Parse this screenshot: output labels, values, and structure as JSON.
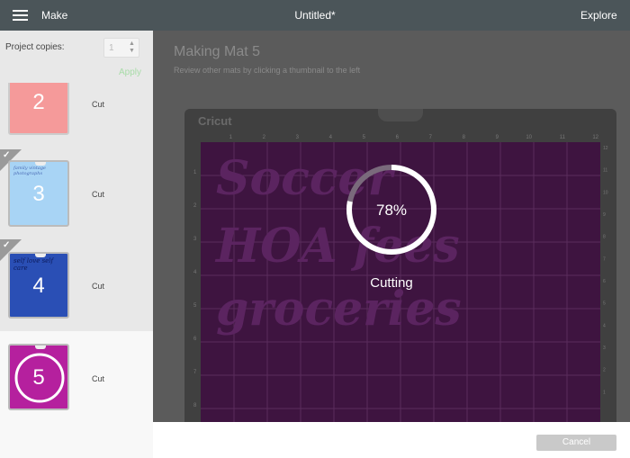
{
  "topbar": {
    "left_label": "Make",
    "title": "Untitled*",
    "right_label": "Explore"
  },
  "sidebar": {
    "copies_label": "Project copies:",
    "copies_value": "1",
    "apply_label": "Apply",
    "mats": [
      {
        "number": "2",
        "action": "Cut",
        "color": "#f59a9a",
        "script": "",
        "completed": false,
        "active": false
      },
      {
        "number": "3",
        "action": "Cut",
        "color": "#a8d4f5",
        "script": "family vintage photographs",
        "completed": true,
        "active": false
      },
      {
        "number": "4",
        "action": "Cut",
        "color": "#2a4fb5",
        "script": "self love self care",
        "completed": true,
        "active": false
      },
      {
        "number": "5",
        "action": "Cut",
        "color": "#b5209e",
        "script": "",
        "completed": false,
        "active": true
      }
    ]
  },
  "main": {
    "title": "Making Mat 5",
    "subtitle": "Review other mats by clicking a thumbnail to the left",
    "mat_brand": "Cricut",
    "mat_color": "#3e1440",
    "ruler_top": [
      "1",
      "2",
      "3",
      "4",
      "5",
      "6",
      "7",
      "8",
      "9",
      "10",
      "11",
      "12"
    ],
    "ruler_right": [
      "12",
      "11",
      "10",
      "9",
      "8",
      "7",
      "6",
      "5",
      "4",
      "3",
      "2",
      "1"
    ],
    "ruler_left": [
      "1",
      "2",
      "3",
      "4",
      "5",
      "6",
      "7",
      "8"
    ],
    "design_lines": [
      "Soccer",
      "HOA fees",
      "groceries"
    ],
    "progress": 78,
    "progress_label": "78%",
    "status": "Cutting"
  },
  "footer": {
    "cancel_label": "Cancel"
  }
}
